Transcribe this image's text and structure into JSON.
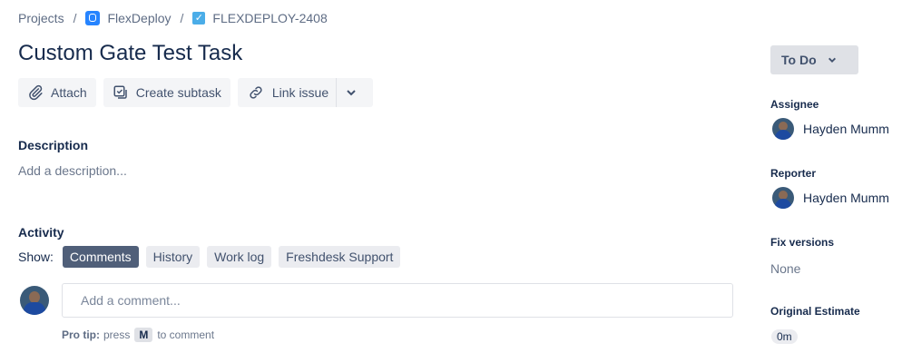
{
  "breadcrumb": {
    "projects": "Projects",
    "project": "FlexDeploy",
    "issue_key": "FLEXDEPLOY-2408",
    "separator": "/"
  },
  "issue": {
    "title": "Custom Gate Test Task"
  },
  "actions": {
    "attach": "Attach",
    "create_subtask": "Create subtask",
    "link_issue": "Link issue"
  },
  "description": {
    "label": "Description",
    "placeholder": "Add a description..."
  },
  "activity": {
    "label": "Activity",
    "show_label": "Show:",
    "tabs": [
      "Comments",
      "History",
      "Work log",
      "Freshdesk Support"
    ],
    "active_tab": "Comments",
    "comment_placeholder": "Add a comment...",
    "protip_bold": "Pro tip:",
    "protip_press": "press",
    "protip_key": "M",
    "protip_rest": "to comment"
  },
  "sidebar": {
    "status": "To Do",
    "assignee_label": "Assignee",
    "assignee": "Hayden Mumm",
    "reporter_label": "Reporter",
    "reporter": "Hayden Mumm",
    "fix_versions_label": "Fix versions",
    "fix_versions": "None",
    "original_estimate_label": "Original Estimate",
    "original_estimate": "0m"
  },
  "colors": {
    "text": "#172b4d",
    "muted": "#6b778c",
    "active_pill": "#505f79",
    "project_icon": "#2684ff",
    "task_icon": "#4bade8"
  }
}
